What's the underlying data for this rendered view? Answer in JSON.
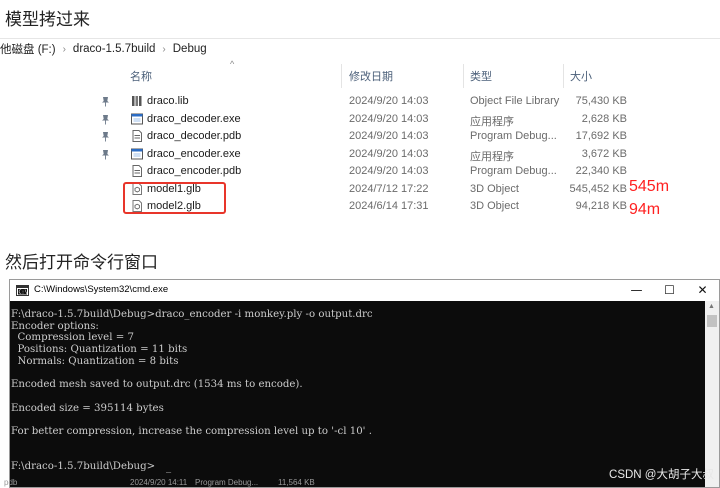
{
  "heading1": "模型拷过来",
  "heading2": "然后打开命令行窗口",
  "breadcrumb": {
    "items": [
      "他磁盘 (F:)",
      "draco-1.5.7build",
      "Debug"
    ]
  },
  "columns": {
    "name": "名称",
    "date": "修改日期",
    "type": "类型",
    "size": "大小"
  },
  "files": [
    {
      "name": "draco.lib",
      "date": "2024/9/20 14:03",
      "type": "Object File Library",
      "size": "75,430 KB",
      "icon": "library-icon",
      "pinned": true
    },
    {
      "name": "draco_decoder.exe",
      "date": "2024/9/20 14:03",
      "type": "应用程序",
      "size": "2,628 KB",
      "icon": "exe-icon",
      "pinned": true
    },
    {
      "name": "draco_decoder.pdb",
      "date": "2024/9/20 14:03",
      "type": "Program Debug...",
      "size": "17,692 KB",
      "icon": "pdb-icon",
      "pinned": true
    },
    {
      "name": "draco_encoder.exe",
      "date": "2024/9/20 14:03",
      "type": "应用程序",
      "size": "3,672 KB",
      "icon": "exe-icon",
      "pinned": true
    },
    {
      "name": "draco_encoder.pdb",
      "date": "2024/9/20 14:03",
      "type": "Program Debug...",
      "size": "22,340 KB",
      "icon": "pdb-icon",
      "pinned": false
    },
    {
      "name": "model1.glb",
      "date": "2024/7/12 17:22",
      "type": "3D Object",
      "size": "545,452 KB",
      "icon": "3d-object-icon",
      "pinned": false
    },
    {
      "name": "model2.glb",
      "date": "2024/6/14 17:31",
      "type": "3D Object",
      "size": "94,218 KB",
      "icon": "3d-object-icon",
      "pinned": false
    }
  ],
  "annotations": {
    "model1": "545m",
    "model2": "94m",
    "color": "#ff2020"
  },
  "cmd": {
    "title": "C:\\Windows\\System32\\cmd.exe",
    "buttons": {
      "minimize": "—",
      "maximize": "☐",
      "close": "✕"
    },
    "lines": [
      "F:\\draco-1.5.7build\\Debug>draco_encoder -i monkey.ply -o output.drc",
      "Encoder options:",
      "  Compression level = 7",
      "  Positions: Quantization = 11 bits",
      "  Normals: Quantization = 8 bits",
      "",
      "Encoded mesh saved to output.drc (1534 ms to encode).",
      "",
      "Encoded size = 395114 bytes",
      "",
      "For better compression, increase the compression level up to '-cl 10' .",
      "",
      "",
      "F:\\draco-1.5.7build\\Debug>"
    ]
  },
  "watermark": "CSDN @大胡子大叔",
  "bottom_row": {
    "name": "pdb",
    "date": "2024/9/20 14:11",
    "type": "Program Debug...",
    "size": "11,564 KB"
  }
}
